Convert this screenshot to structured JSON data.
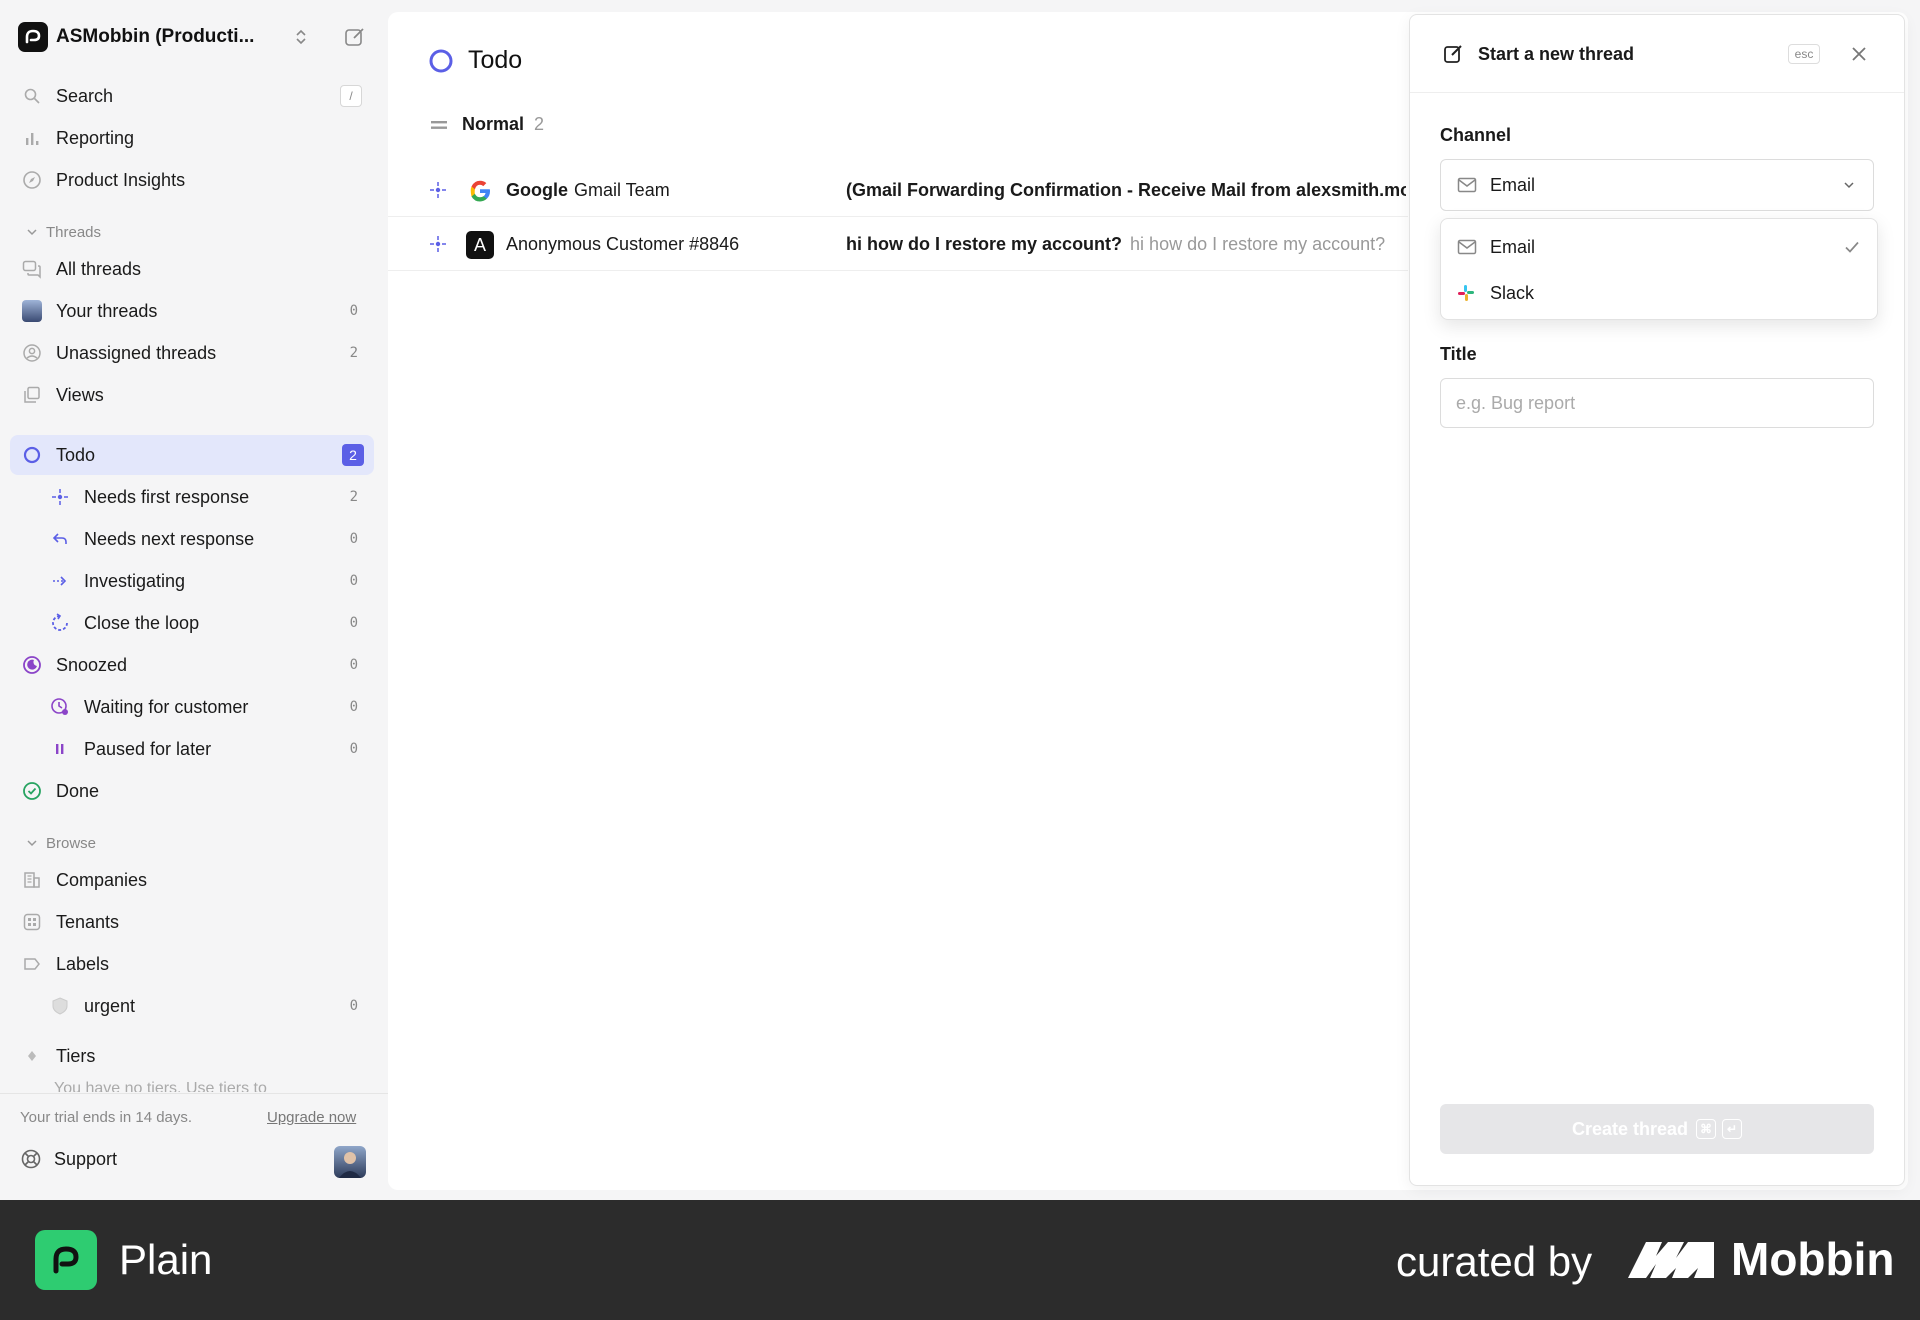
{
  "workspace": {
    "name": "ASMobbin (Producti..."
  },
  "nav": {
    "search": "Search",
    "search_kbd": "/",
    "reporting": "Reporting",
    "product_insights": "Product Insights",
    "threads_section": "Threads",
    "all_threads": "All threads",
    "your_threads": "Your threads",
    "your_threads_count": "0",
    "unassigned": "Unassigned threads",
    "unassigned_count": "2",
    "views": "Views",
    "todo": "Todo",
    "todo_count": "2",
    "needs_first": "Needs first response",
    "needs_first_count": "2",
    "needs_next": "Needs next response",
    "needs_next_count": "0",
    "investigating": "Investigating",
    "investigating_count": "0",
    "close_loop": "Close the loop",
    "close_loop_count": "0",
    "snoozed": "Snoozed",
    "snoozed_count": "0",
    "waiting": "Waiting for customer",
    "waiting_count": "0",
    "paused": "Paused for later",
    "paused_count": "0",
    "done": "Done",
    "browse_section": "Browse",
    "companies": "Companies",
    "tenants": "Tenants",
    "labels": "Labels",
    "urgent": "urgent",
    "urgent_count": "0",
    "tiers": "Tiers",
    "tiers_hint": "You have no tiers. Use tiers to"
  },
  "trial": {
    "text": "Your trial ends in 14 days.",
    "upgrade": "Upgrade now"
  },
  "support": "Support",
  "main": {
    "title": "Todo",
    "group": {
      "label": "Normal",
      "count": "2"
    },
    "rows": [
      {
        "customer": "Google",
        "customer2": "Gmail Team",
        "subject": "(Gmail Forwarding Confirmation - Receive Mail from alexsmith.mo",
        "preview": ""
      },
      {
        "avatar": "A",
        "customer": "Anonymous Customer #8846",
        "customer2": "",
        "subject": "hi how do I restore my account?",
        "preview": "hi how do I restore my account?"
      }
    ]
  },
  "panel": {
    "title": "Start a new thread",
    "esc": "esc",
    "channel_label": "Channel",
    "channel_value": "Email",
    "options": [
      "Email",
      "Slack"
    ],
    "title_label": "Title",
    "title_placeholder": "e.g. Bug report",
    "create": "Create thread",
    "create_kbd1": "⌘",
    "create_kbd2": "↵"
  },
  "footer": {
    "brand": "Plain",
    "curated": "curated by",
    "mobbin": "Mobbin"
  },
  "colors": {
    "accent": "#5b5fe6",
    "plain_green": "#2ecc71",
    "footer_bg": "#2c2c2c"
  }
}
